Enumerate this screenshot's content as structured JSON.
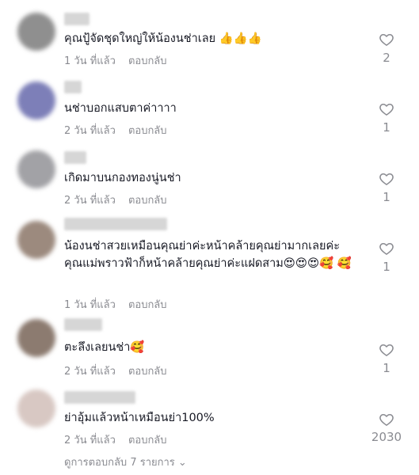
{
  "comments": [
    {
      "text": "คุณปู้จัดชุดใหญ่ให้น้องนช่าเลย 👍👍👍",
      "time": "1 วัน ที่แล้ว",
      "reply": "ตอบกลับ",
      "likes": "2",
      "avatar_color": "#8f8f8f"
    },
    {
      "text": "นช่าบอกแสบตาค่าาาา",
      "time": "2 วัน ที่แล้ว",
      "reply": "ตอบกลับ",
      "likes": "1",
      "avatar_color": "#7d7fb8"
    },
    {
      "text": "เกิดมาบนกองทองนู่นช่า",
      "time": "2 วัน ที่แล้ว",
      "reply": "ตอบกลับ",
      "likes": "1",
      "avatar_color": "#a2a2a6"
    },
    {
      "text": "น้องนช่าสวยเหมือนคุณย่าค่ะหน้าคล้ายคุณย่ามากเลยค่ะ คุณแม่พราวฟ้าก็หน้าคล้ายคุณย่าค่ะแฝดสาม😍😍😍🥰 🥰",
      "time": "1 วัน ที่แล้ว",
      "reply": "ตอบกลับ",
      "likes": "1",
      "avatar_color": "#9c8a7e"
    },
    {
      "text": "ตะลึงเลยนช่า🥰",
      "time": "2 วัน ที่แล้ว",
      "reply": "ตอบกลับ",
      "likes": "1",
      "avatar_color": "#8c7b70"
    },
    {
      "text": "ย่าอุ้มแล้วหน้าเหมือนย่า100%",
      "time": "2 วัน ที่แล้ว",
      "reply": "ตอบกลับ",
      "likes": "2030",
      "avatar_color": "#d8c8c3"
    }
  ],
  "view_replies": "ดูการตอบกลับ 7 รายการ ⌄",
  "colors": {
    "text": "#161823",
    "muted": "#8a8b91"
  }
}
